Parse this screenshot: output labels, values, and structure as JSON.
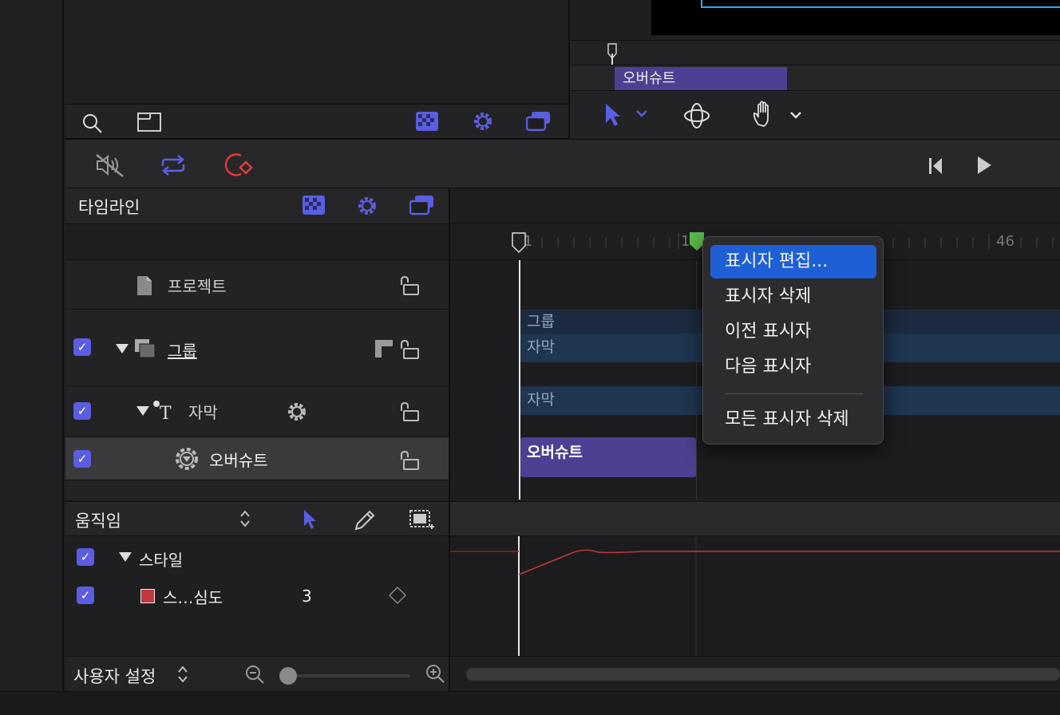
{
  "viewer": {
    "mini_timeline_clip": "오버슈트"
  },
  "timeline": {
    "title": "타임라인",
    "ruler_marks": [
      "1",
      "1",
      "46"
    ],
    "layers": [
      {
        "name": "프로젝트"
      },
      {
        "name": "그룹",
        "checked": true
      },
      {
        "name": "자막",
        "checked": true
      },
      {
        "name": "오버슈트",
        "checked": true
      }
    ],
    "tracks": {
      "group_label": "그룹",
      "group_sub": "자막",
      "caption": "자막",
      "behavior": "오버슈트"
    }
  },
  "context_menu": {
    "items": [
      "표시자 편집...",
      "표시자 삭제",
      "이전 표시자",
      "다음 표시자",
      "모든 표시자 삭제"
    ],
    "highlighted": "표시자 편집..."
  },
  "motion": {
    "title": "움직임",
    "rows": [
      {
        "name": "스타일",
        "checked": true
      },
      {
        "name": "스…심도",
        "value": "3",
        "checked": true,
        "swatch": "#c0393b"
      }
    ]
  },
  "footer": {
    "preset": "사용자 설정"
  },
  "colors": {
    "accent": "#5b5ee0",
    "marker": "#58b84a",
    "record": "#e03b3b",
    "menu_highlight": "#1f5fd6",
    "clip_purple": "#4d3f92"
  }
}
